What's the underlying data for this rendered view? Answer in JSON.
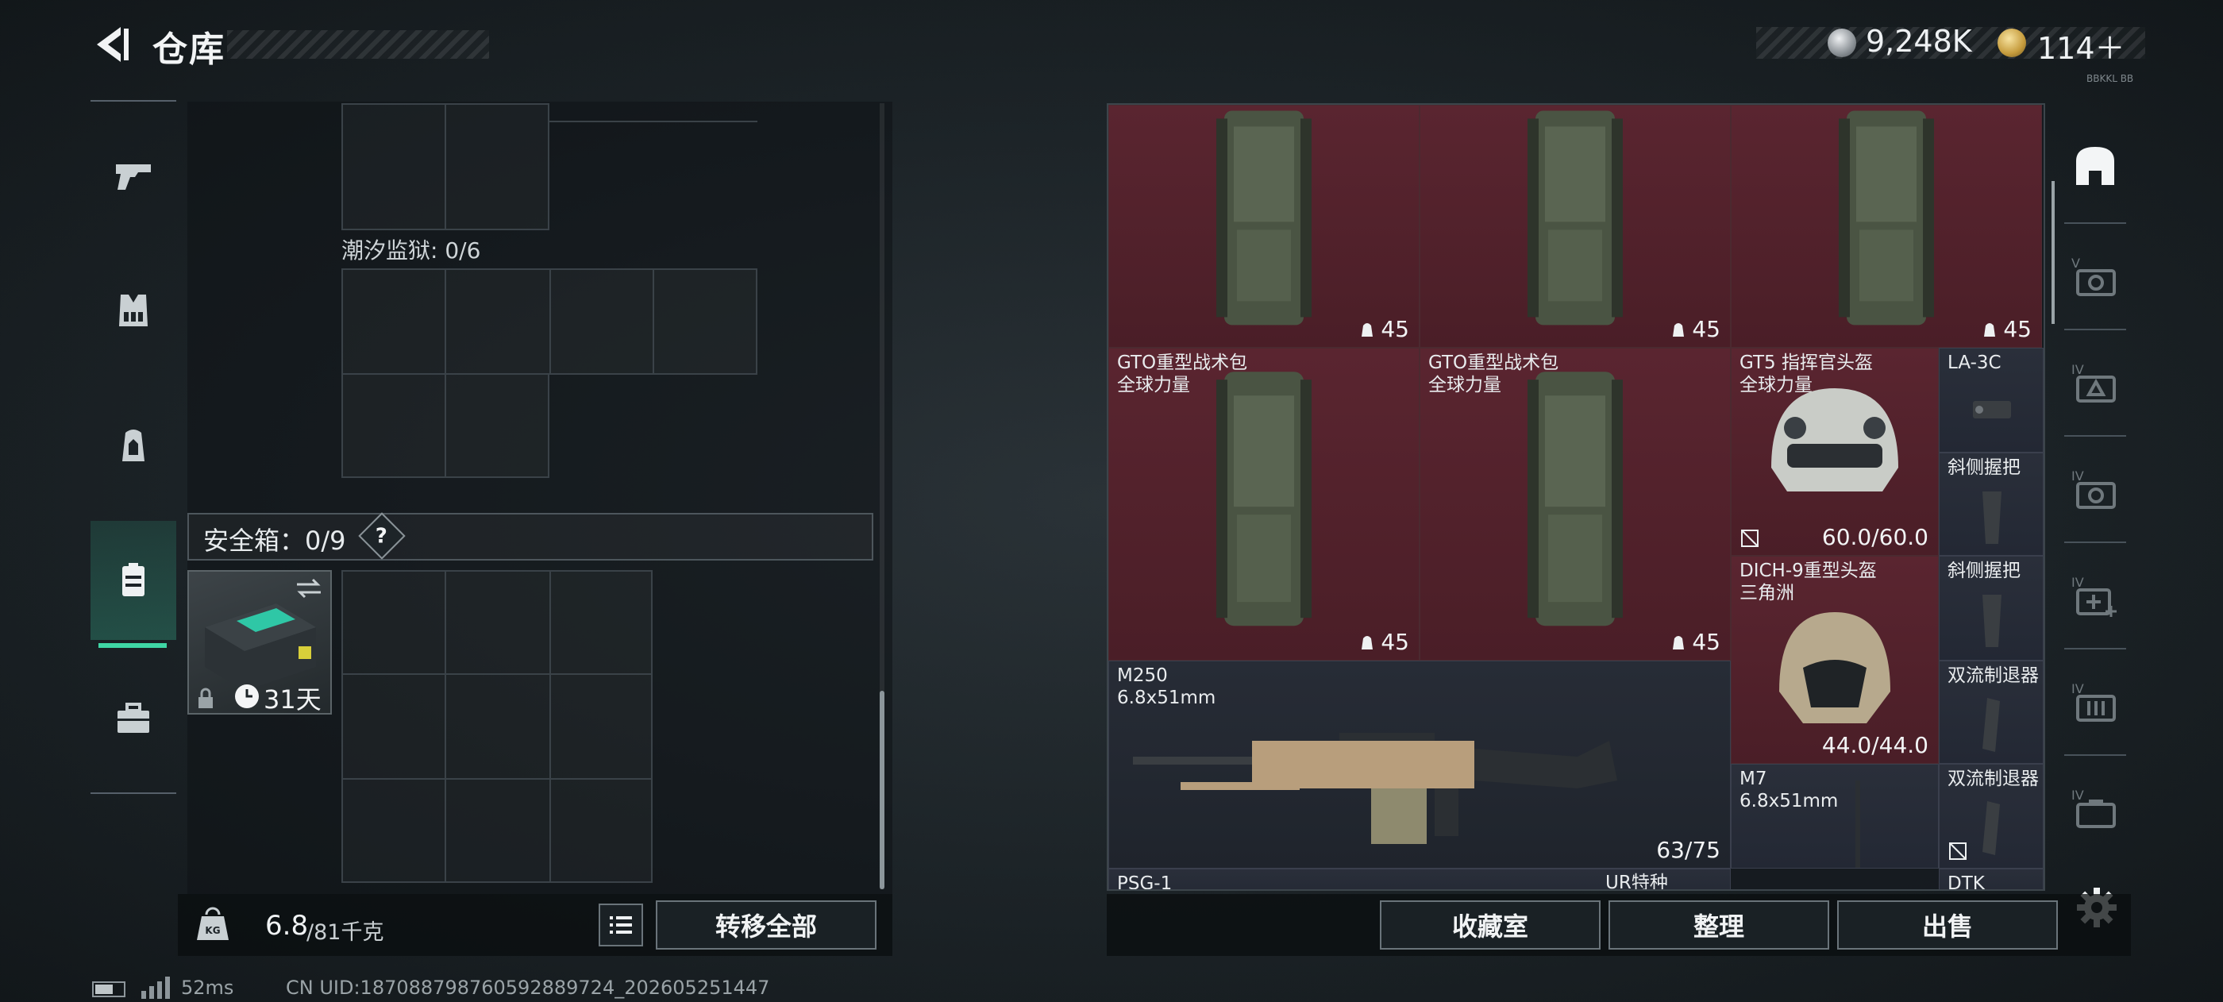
{
  "header": {
    "title": "仓库",
    "currency": [
      {
        "icon": "silver-coin-icon",
        "value": "9,248K"
      },
      {
        "icon": "gold-triangle-coin-icon",
        "value": "114＋"
      }
    ],
    "tiny_text": "BBKKL BB"
  },
  "left_rail": {
    "items": [
      "gun-icon",
      "vest-icon",
      "backpack-icon",
      "safebox-icon",
      "toolbox-icon"
    ],
    "active": "safebox-icon"
  },
  "left_panel": {
    "prison_label": "潮汐监狱: 0/6",
    "safebox_label": "安全箱：0/9",
    "help_label": "?",
    "safebox_days": "31天"
  },
  "bottom_left": {
    "weight_value": "6.8",
    "weight_max": "/81千克",
    "transfer_label": "转移全部"
  },
  "status": {
    "ping": "52ms",
    "uid": "CN UID:187088798760592889724_202605251447"
  },
  "stash": {
    "items": [
      {
        "name": "",
        "name2": "",
        "count": "45"
      },
      {
        "name": "",
        "name2": "",
        "count": "45"
      },
      {
        "name": "",
        "name2": "",
        "count": "45"
      },
      {
        "name": "GTO重型战术包",
        "name2": "全球力量",
        "count": "45"
      },
      {
        "name": "GTO重型战术包",
        "name2": "全球力量",
        "count": "45"
      },
      {
        "name": "GT5 指挥官头盔",
        "name2": "全球力量",
        "durability": "60.0/60.0"
      },
      {
        "name": "LA-3C"
      },
      {
        "name": "斜侧握把"
      },
      {
        "name": "DICH-9重型头盔",
        "name2": "三角洲",
        "durability": "44.0/44.0"
      },
      {
        "name": "斜侧握把"
      },
      {
        "name": "双流制退器"
      },
      {
        "name": "M250",
        "name2": "6.8x51mm",
        "ammo": "63/75"
      },
      {
        "name": "M7",
        "name2": "6.8x51mm"
      },
      {
        "name": "双流制退器"
      },
      {
        "name": "PSG-1"
      },
      {
        "name": "UR特种"
      },
      {
        "name": "DTK"
      }
    ]
  },
  "right_rail": {
    "items": [
      "home-icon",
      "camera-mod-icon",
      "sight-mod-icon",
      "camera-mod-icon-2",
      "medkit-mod-icon",
      "ammo-mod-icon",
      "case-mod-icon"
    ]
  },
  "bottom_right": {
    "collection_label": "收藏室",
    "sort_label": "整理",
    "sell_label": "出售"
  },
  "colors": {
    "accent": "#3fd6a5",
    "item_red": "#5a2530",
    "item_dark": "#2a2f3a"
  }
}
